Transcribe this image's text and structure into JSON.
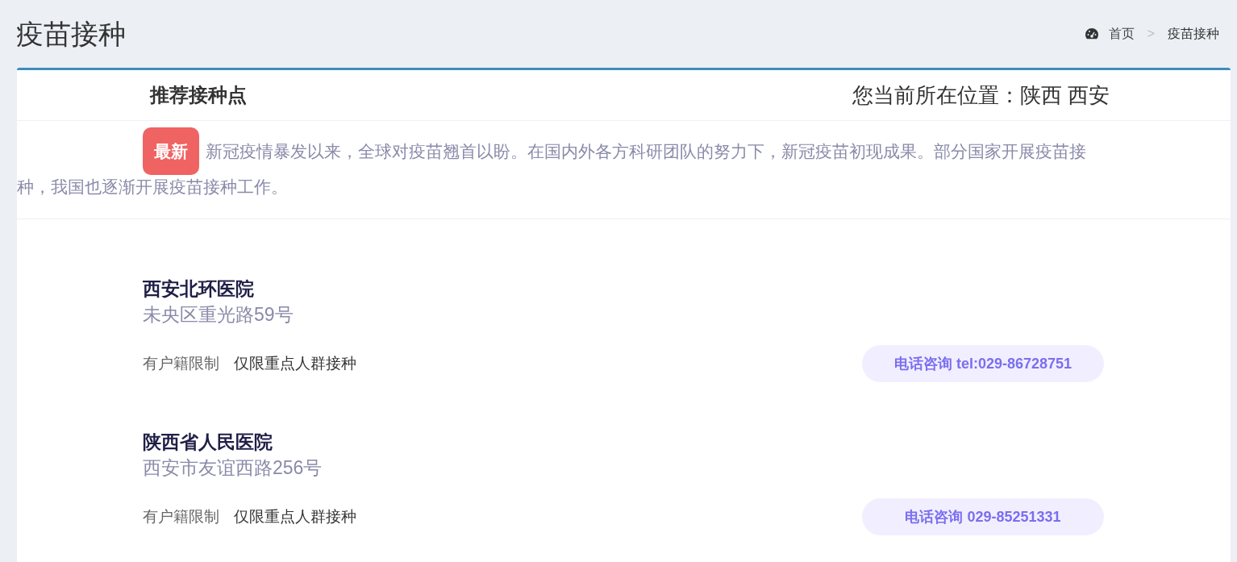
{
  "page_title": "疫苗接种",
  "breadcrumb": [
    {
      "label": "首页",
      "selected": false
    },
    {
      "label": "疫苗接种",
      "selected": true
    }
  ],
  "breadcrumb_separator": ">",
  "card": {
    "title": "推荐接种点",
    "location": "您当前所在位置：陕西 西安"
  },
  "news": {
    "badge": "最新",
    "lines": [
      "新冠疫情暴发以来，全球对疫苗翘首以盼。在国内外各方科研团队的努力下，新冠疫苗初现成果。部分国家开展疫苗接",
      "种，我国也逐渐开展疫苗接种工作。"
    ]
  },
  "sites": [
    {
      "name": "西安北环医院",
      "address": "未央区重光路59号",
      "tags": [
        "有户籍限制",
        "仅限重点人群接种"
      ],
      "phone": "电话咨询 tel:029-86728751"
    },
    {
      "name": "陕西省人民医院",
      "address": "西安市友谊西路256号",
      "tags": [
        "有户籍限制",
        "仅限重点人群接种"
      ],
      "phone": "电话咨询 029-85251331"
    }
  ]
}
